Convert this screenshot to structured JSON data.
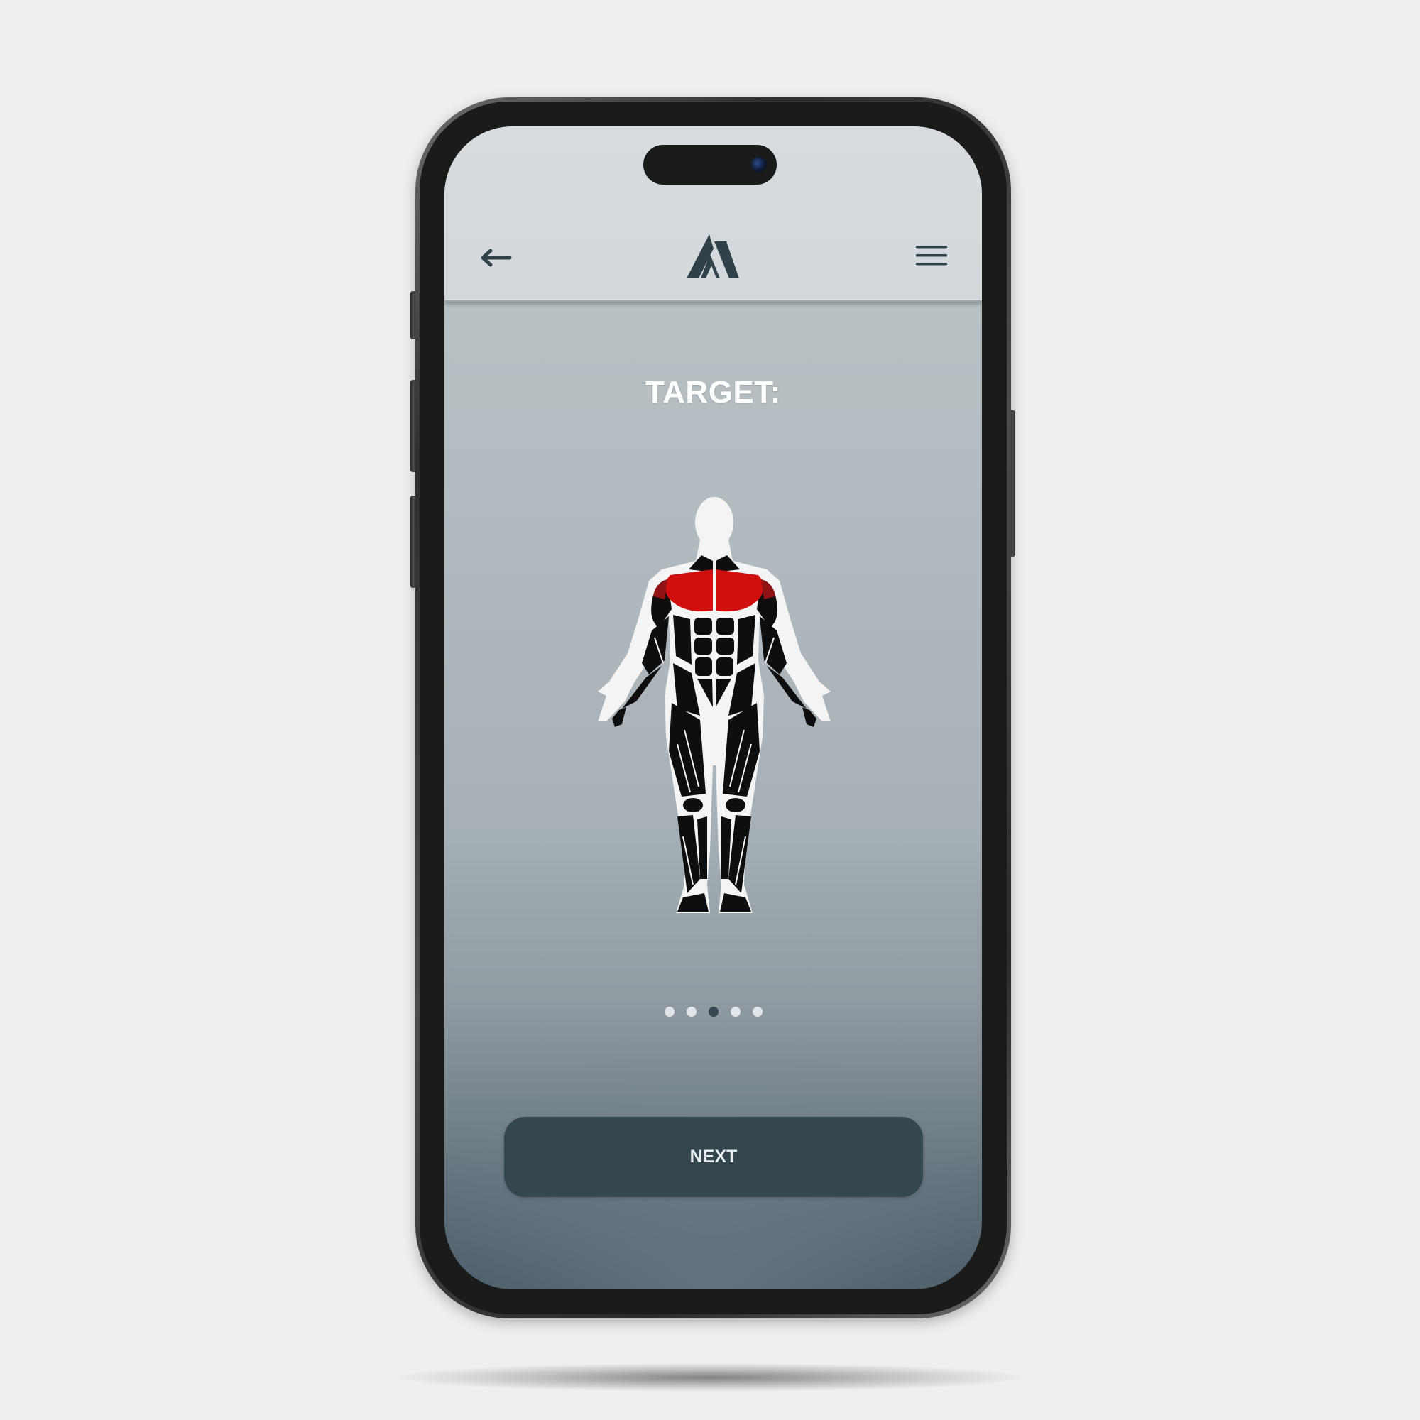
{
  "header": {
    "back_icon": "arrow-left-icon",
    "logo_icon": "mountain-logo-icon",
    "menu_icon": "hamburger-menu-icon"
  },
  "main": {
    "title": "TARGET:",
    "figure": {
      "icon": "muscle-anatomy-figure-icon",
      "highlighted_muscle_color": "#d10f0f"
    }
  },
  "pager": {
    "total": 5,
    "active_index": 2
  },
  "footer": {
    "next_label": "NEXT"
  },
  "colors": {
    "accent": "#34474f",
    "header_bg": "#d6dadd",
    "highlight": "#d10f0f"
  }
}
